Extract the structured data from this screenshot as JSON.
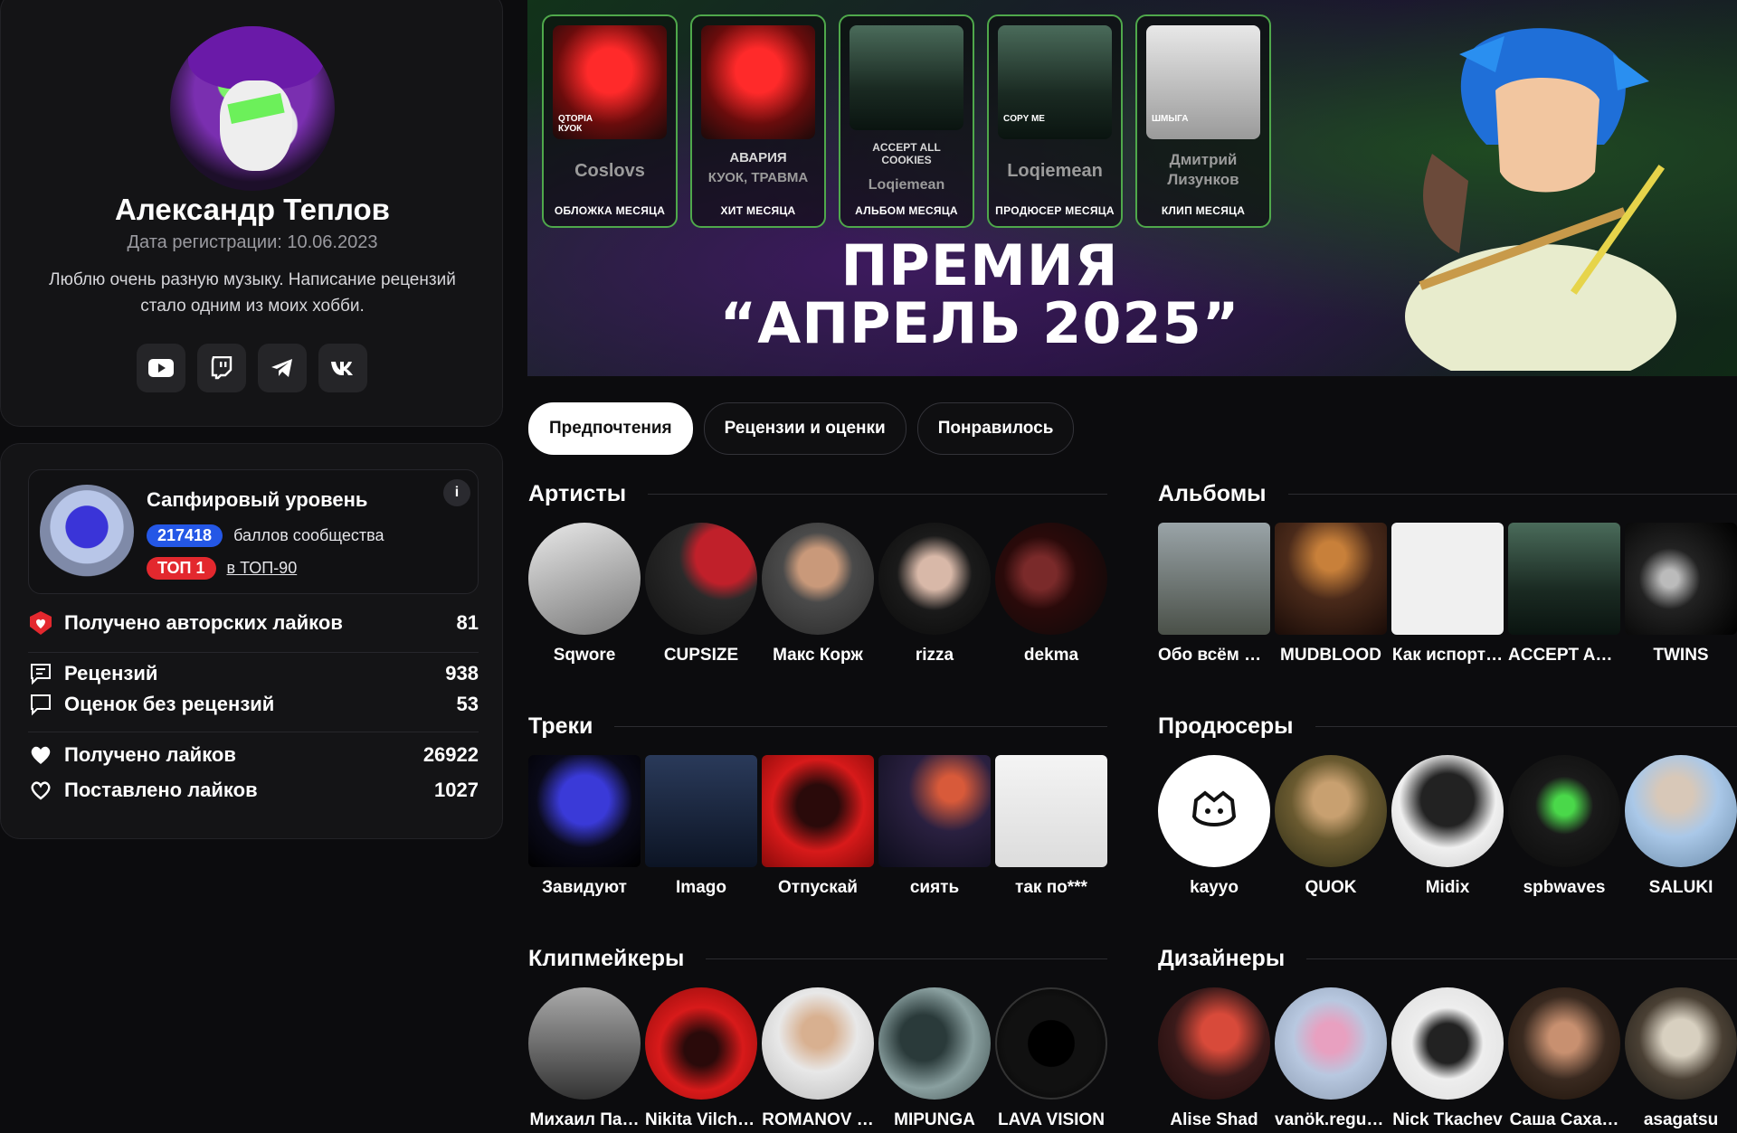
{
  "profile": {
    "name": "Александр Теплов",
    "reg_date": "Дата регистрации: 10.06.2023",
    "bio": "Люблю очень разную музыку. Написание рецензий стало одним из моих хобби.",
    "socials": [
      "youtube-icon",
      "twitch-icon",
      "telegram-icon",
      "vk-icon"
    ]
  },
  "level": {
    "title": "Сапфировый уровень",
    "points": "217418",
    "points_label": "баллов сообщества",
    "top_badge": "ТОП 1",
    "top_label": "в ТОП-90",
    "info": "i"
  },
  "stats": {
    "author_likes_label": "Получено авторских лайков",
    "author_likes": "81",
    "reviews_label": "Рецензий",
    "reviews": "938",
    "ratings_label": "Оценок без рецензий",
    "ratings": "53",
    "likes_received_label": "Получено лайков",
    "likes_received": "26922",
    "likes_given_label": "Поставлено лайков",
    "likes_given": "1027"
  },
  "banner": {
    "title_line1": "ПРЕМИЯ",
    "title_line2": "“АПРЕЛЬ 2025”",
    "awards": [
      {
        "thumb_text": "QTOPIA\nКУОК",
        "title": "",
        "name": "Coslovs",
        "category": "ОБЛОЖКА МЕСЯЦА"
      },
      {
        "thumb_text": "",
        "title": "АВАРИЯ",
        "name": "КУОК, ТРАВМА",
        "category": "ХИТ МЕСЯЦА"
      },
      {
        "thumb_text": "",
        "title": "ACCEPT ALL COOKIES",
        "name": "Loqiemean",
        "category": "АЛЬБОМ МЕСЯЦА"
      },
      {
        "thumb_text": "COPY ME",
        "title": "",
        "name": "Loqiemean",
        "category": "ПРОДЮСЕР МЕСЯЦА"
      },
      {
        "thumb_text": "ШМЫГА",
        "title": "",
        "name": "Дмитрий Лизунков",
        "category": "КЛИП МЕСЯЦА"
      }
    ]
  },
  "tabs": [
    "Предпочтения",
    "Рецензии и оценки",
    "Понравилось"
  ],
  "sections": {
    "artists": {
      "title": "Артисты",
      "items": [
        "Sqwore",
        "CUPSIZE",
        "Макс Корж",
        "rizza",
        "dekma"
      ]
    },
    "albums": {
      "title": "Альбомы",
      "items": [
        "Обо всём и…",
        "MUDBLOOD",
        "Как испорт…",
        "ACCEPT AL…",
        "TWINS"
      ]
    },
    "tracks": {
      "title": "Треки",
      "items": [
        "Завидуют",
        "Imago",
        "Отпускай",
        "сиять",
        "так по***"
      ]
    },
    "producers": {
      "title": "Продюсеры",
      "items": [
        "kayyo",
        "QUOK",
        "Midix",
        "spbwaves",
        "SALUKI"
      ]
    },
    "clipmakers": {
      "title": "Клипмейкеры",
      "items": [
        "Михаил Па…",
        "Nikita Vilchi…",
        "ROMANOV …",
        "MIPUNGA",
        "LAVA VISION"
      ]
    },
    "designers": {
      "title": "Дизайнеры",
      "items": [
        "Alise Shad",
        "vanök.regular",
        "Nick Tkachev",
        "Саша Саха…",
        "asagatsu"
      ]
    }
  },
  "colors": {
    "accent_blue": "#2457e6",
    "accent_red": "#e3282e",
    "banner_green": "#4fa84b"
  }
}
